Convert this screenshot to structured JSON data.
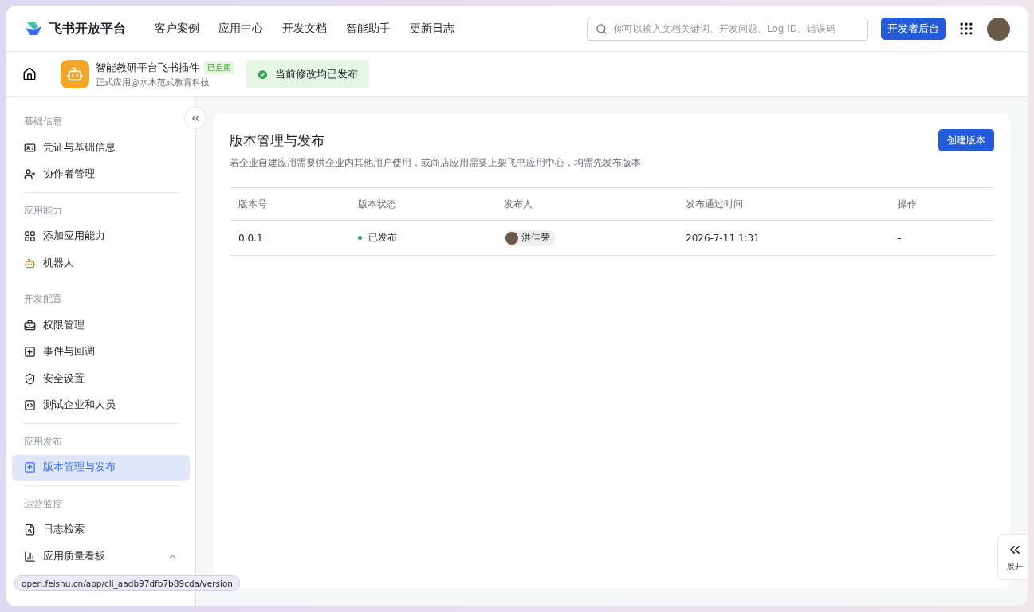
{
  "header": {
    "brand": "飞书开放平台",
    "nav": [
      {
        "label": "客户案例",
        "selected": false
      },
      {
        "label": "应用中心",
        "selected": false
      },
      {
        "label": "开发文档",
        "selected": false
      },
      {
        "label": "智能助手",
        "selected": false
      },
      {
        "label": "更新日志",
        "selected": false
      }
    ],
    "search": {
      "placeholder": "你可以输入文档关键词、开发问题、Log ID、错误码"
    },
    "console_button": "开发者后台"
  },
  "app_bar": {
    "name": "智能教研平台飞书插件",
    "badge": "已启用",
    "owner": "正式应用@水木范式教育科技",
    "notice": "当前修改均已发布"
  },
  "sidebar": {
    "groups": [
      {
        "title": "基础信息",
        "items": [
          {
            "label": "凭证与基础信息",
            "selected": false
          },
          {
            "label": "协作者管理",
            "selected": false
          }
        ]
      },
      {
        "title": "应用能力",
        "items": [
          {
            "label": "添加应用能力",
            "selected": false
          },
          {
            "label": "机器人",
            "selected": false
          }
        ]
      },
      {
        "title": "开发配置",
        "items": [
          {
            "label": "权限管理",
            "selected": false
          },
          {
            "label": "事件与回调",
            "selected": false
          },
          {
            "label": "安全设置",
            "selected": false
          },
          {
            "label": "测试企业和人员",
            "selected": false
          }
        ]
      },
      {
        "title": "应用发布",
        "items": [
          {
            "label": "版本管理与发布",
            "selected": true
          }
        ]
      },
      {
        "title": "运营监控",
        "items": [
          {
            "label": "日志检索",
            "selected": false
          },
          {
            "label": "应用质量看板",
            "selected": false,
            "expanded": true
          }
        ]
      }
    ]
  },
  "page": {
    "title": "版本管理与发布",
    "description": "若企业自建应用需要供企业内其他用户使用，或商店应用需要上架飞书应用中心，均需先发布版本",
    "create_button": "创建版本",
    "table": {
      "columns": [
        "版本号",
        "版本状态",
        "发布人",
        "发布通过时间",
        "操作"
      ],
      "rows": [
        {
          "version": "0.0.1",
          "status": "已发布",
          "color": "#34a853",
          "publisher": "洪佳荣",
          "time": "2026-7-11 1:31",
          "action": "-"
        }
      ]
    }
  },
  "expand_tab": {
    "label": "展开"
  },
  "status_url": "open.feishu.cn/app/cli_aadb97dfb7b89cda/version"
}
